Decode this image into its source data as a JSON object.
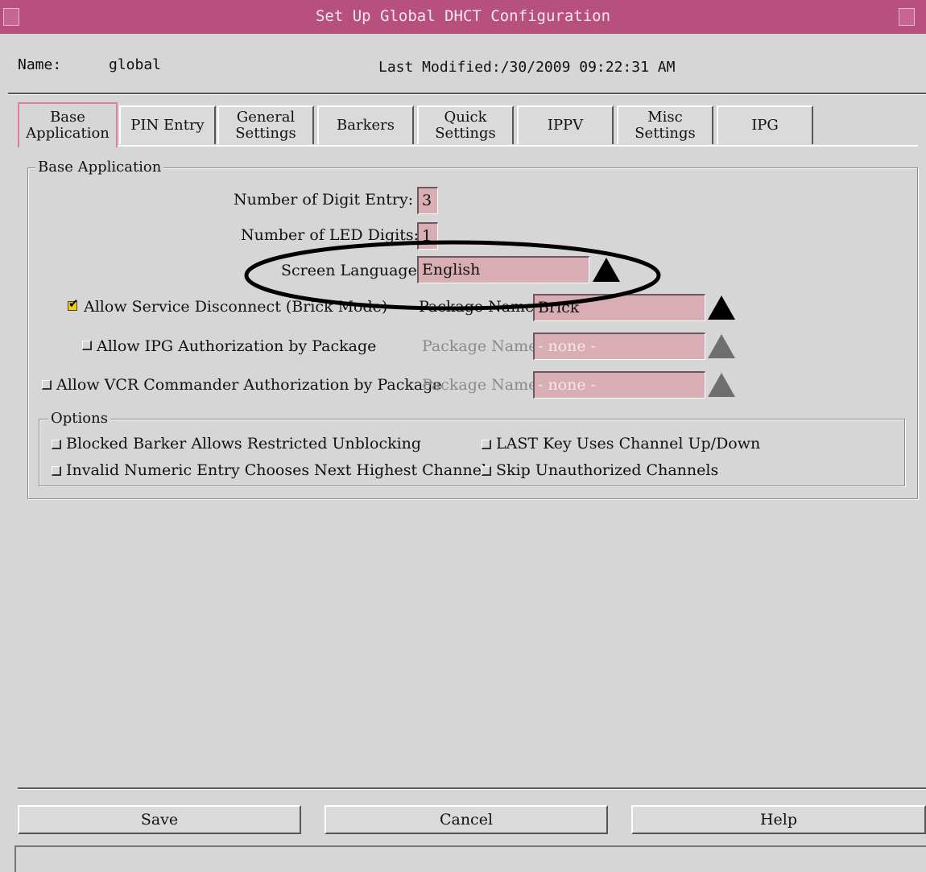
{
  "window": {
    "title": "Set Up Global DHCT Configuration"
  },
  "header": {
    "name_label": "Name:",
    "name_value": "global",
    "last_modified_label": "Last Modified:",
    "last_modified_value": "/30/2009 09:22:31 AM"
  },
  "tabs": [
    {
      "label": "Base\nApplication",
      "active": true
    },
    {
      "label": "PIN Entry",
      "active": false
    },
    {
      "label": "General\nSettings",
      "active": false
    },
    {
      "label": "Barkers",
      "active": false
    },
    {
      "label": "Quick\nSettings",
      "active": false
    },
    {
      "label": "IPPV",
      "active": false
    },
    {
      "label": "Misc\nSettings",
      "active": false
    },
    {
      "label": "IPG",
      "active": false
    }
  ],
  "base_application": {
    "group_label": "Base Application",
    "digit_entry_label": "Number of Digit Entry:",
    "digit_entry_value": "3",
    "led_digits_label": "Number of LED Digits:",
    "led_digits_value": "1",
    "screen_language_label": "Screen Language:",
    "screen_language_value": "English",
    "allow_service_disconnect": {
      "label": "Allow Service Disconnect (Brick Mode)",
      "checked": true,
      "package_label": "Package Name:",
      "package_value": "Brick"
    },
    "allow_ipg_auth": {
      "label": "Allow IPG Authorization by Package",
      "checked": false,
      "package_label": "Package Name:",
      "package_value": "- none -"
    },
    "allow_vcr_auth": {
      "label": "Allow VCR Commander Authorization by Package",
      "checked": false,
      "package_label": "Package Name:",
      "package_value": "- none -"
    }
  },
  "options": {
    "group_label": "Options",
    "items": [
      {
        "label": "Blocked Barker Allows Restricted Unblocking",
        "checked": false
      },
      {
        "label": "LAST Key Uses Channel Up/Down",
        "checked": false
      },
      {
        "label": "Invalid Numeric Entry Chooses Next Highest Channel",
        "checked": false
      },
      {
        "label": "Skip Unauthorized Channels",
        "checked": false
      }
    ]
  },
  "buttons": {
    "save": "Save",
    "cancel": "Cancel",
    "help": "Help"
  },
  "colors": {
    "titlebar": "#b8507e",
    "field_bg": "#d8aeb4",
    "active_tab_border": "#d97fa5",
    "checkbox_checked": "#f0d000"
  }
}
